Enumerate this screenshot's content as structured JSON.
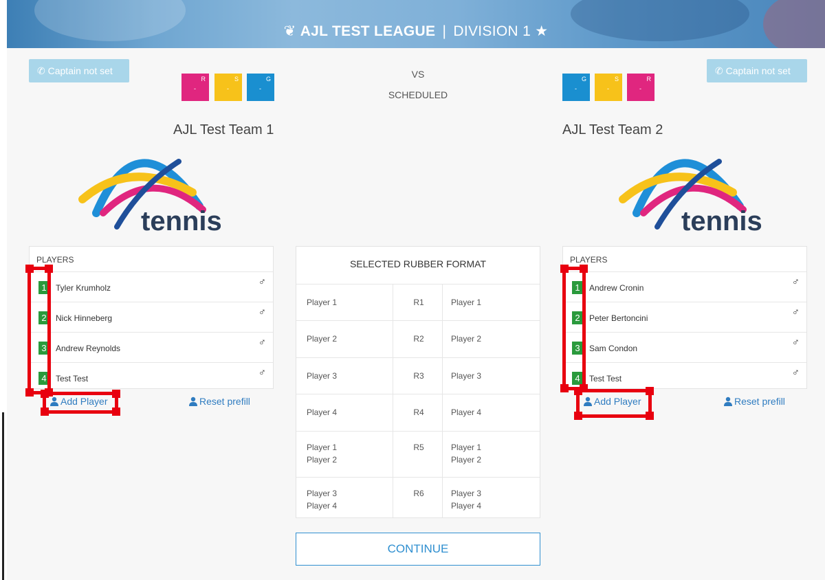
{
  "header": {
    "league": "AJL TEST LEAGUE",
    "separator": "|",
    "division": "DIVISION 1",
    "league_icon": "tennis-rackets-icon",
    "star_icon": "star-icon"
  },
  "match": {
    "vs": "VS",
    "status": "SCHEDULED"
  },
  "home": {
    "captain_label": "Captain not set",
    "team_name": "AJL Test Team 1",
    "squares": [
      {
        "letter": "R",
        "value": "-",
        "color": "#e0267f"
      },
      {
        "letter": "S",
        "value": "-",
        "color": "#f7c21a"
      },
      {
        "letter": "G",
        "value": "-",
        "color": "#1a8fd0"
      }
    ],
    "logo_text": "tennis",
    "players_header": "PLAYERS",
    "players": [
      {
        "num": "1",
        "name": "Tyler Krumholz",
        "gender": "♂"
      },
      {
        "num": "2",
        "name": "Nick Hinneberg",
        "gender": "♂"
      },
      {
        "num": "3",
        "name": "Andrew Reynolds",
        "gender": "♂"
      },
      {
        "num": "4",
        "name": "Test Test",
        "gender": "♂"
      }
    ],
    "add_player": "Add Player",
    "reset_prefill": "Reset prefill"
  },
  "away": {
    "captain_label": "Captain not set",
    "team_name": "AJL Test Team 2",
    "squares": [
      {
        "letter": "G",
        "value": "-",
        "color": "#1a8fd0"
      },
      {
        "letter": "S",
        "value": "-",
        "color": "#f7c21a"
      },
      {
        "letter": "R",
        "value": "-",
        "color": "#e0267f"
      }
    ],
    "logo_text": "tennis",
    "players_header": "PLAYERS",
    "players": [
      {
        "num": "1",
        "name": "Andrew Cronin",
        "gender": "♂"
      },
      {
        "num": "2",
        "name": "Peter Bertoncini",
        "gender": "♂"
      },
      {
        "num": "3",
        "name": "Sam Condon",
        "gender": "♂"
      },
      {
        "num": "4",
        "name": "Test Test",
        "gender": "♂"
      }
    ],
    "add_player": "Add Player",
    "reset_prefill": "Reset prefill"
  },
  "rubber": {
    "title": "SELECTED RUBBER FORMAT",
    "rows": [
      {
        "home": "Player 1",
        "code": "R1",
        "away": "Player 1"
      },
      {
        "home": "Player 2",
        "code": "R2",
        "away": "Player 2"
      },
      {
        "home": "Player 3",
        "code": "R3",
        "away": "Player 3"
      },
      {
        "home": "Player 4",
        "code": "R4",
        "away": "Player 4"
      },
      {
        "home": "Player 1\nPlayer 2",
        "code": "R5",
        "away": "Player 1\nPlayer 2"
      },
      {
        "home": "Player 3\nPlayer 4",
        "code": "R6",
        "away": "Player 3\nPlayer 4"
      }
    ]
  },
  "continue_label": "CONTINUE",
  "colors": {
    "accent": "#2f8fd0",
    "player_number": "#2a9a3c",
    "captain_button": "#a9d6ea",
    "annotation": "#e8000f"
  }
}
